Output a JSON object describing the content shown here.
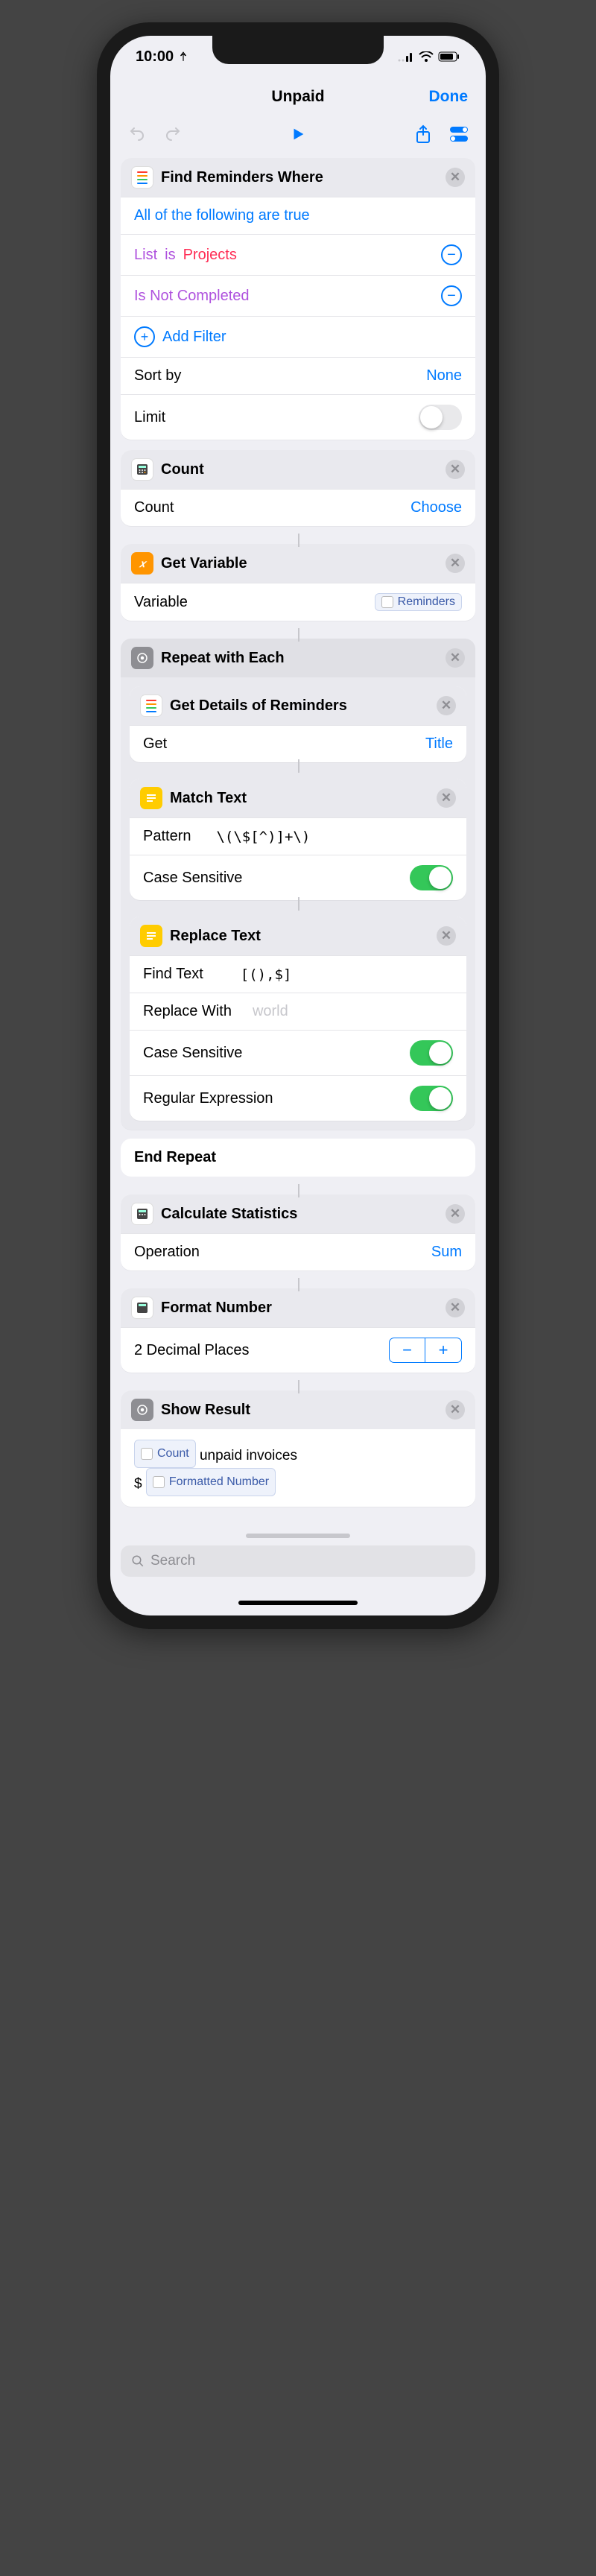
{
  "status": {
    "time": "10:00"
  },
  "nav": {
    "title": "Unpaid",
    "done": "Done"
  },
  "findReminders": {
    "title": "Find Reminders Where",
    "allTrue": "All of the following are true",
    "list_label": "List",
    "is_label": "is",
    "list_value": "Projects",
    "notCompleted": "Is Not Completed",
    "addFilter": "Add Filter",
    "sortBy": "Sort by",
    "sortValue": "None",
    "limit": "Limit"
  },
  "count": {
    "title": "Count",
    "label": "Count",
    "value": "Choose"
  },
  "getVar": {
    "title": "Get Variable",
    "label": "Variable",
    "token": "Reminders"
  },
  "repeat": {
    "title": "Repeat with Each",
    "end": "End Repeat"
  },
  "getDetails": {
    "title": "Get Details of Reminders",
    "label": "Get",
    "value": "Title"
  },
  "matchText": {
    "title": "Match Text",
    "pattern_label": "Pattern",
    "pattern_value": "\\(\\$[^)]+\\)",
    "cs_label": "Case Sensitive"
  },
  "replaceText": {
    "title": "Replace Text",
    "find_label": "Find Text",
    "find_value": "[(),$]",
    "replace_label": "Replace With",
    "replace_placeholder": "world",
    "cs_label": "Case Sensitive",
    "re_label": "Regular Expression"
  },
  "calcStats": {
    "title": "Calculate Statistics",
    "op_label": "Operation",
    "op_value": "Sum"
  },
  "formatNum": {
    "title": "Format Number",
    "label": "2 Decimal Places"
  },
  "showResult": {
    "title": "Show Result",
    "token1": "Count",
    "text1": "unpaid invoices",
    "prefix": "$",
    "token2": "Formatted Number"
  },
  "search": {
    "placeholder": "Search"
  }
}
